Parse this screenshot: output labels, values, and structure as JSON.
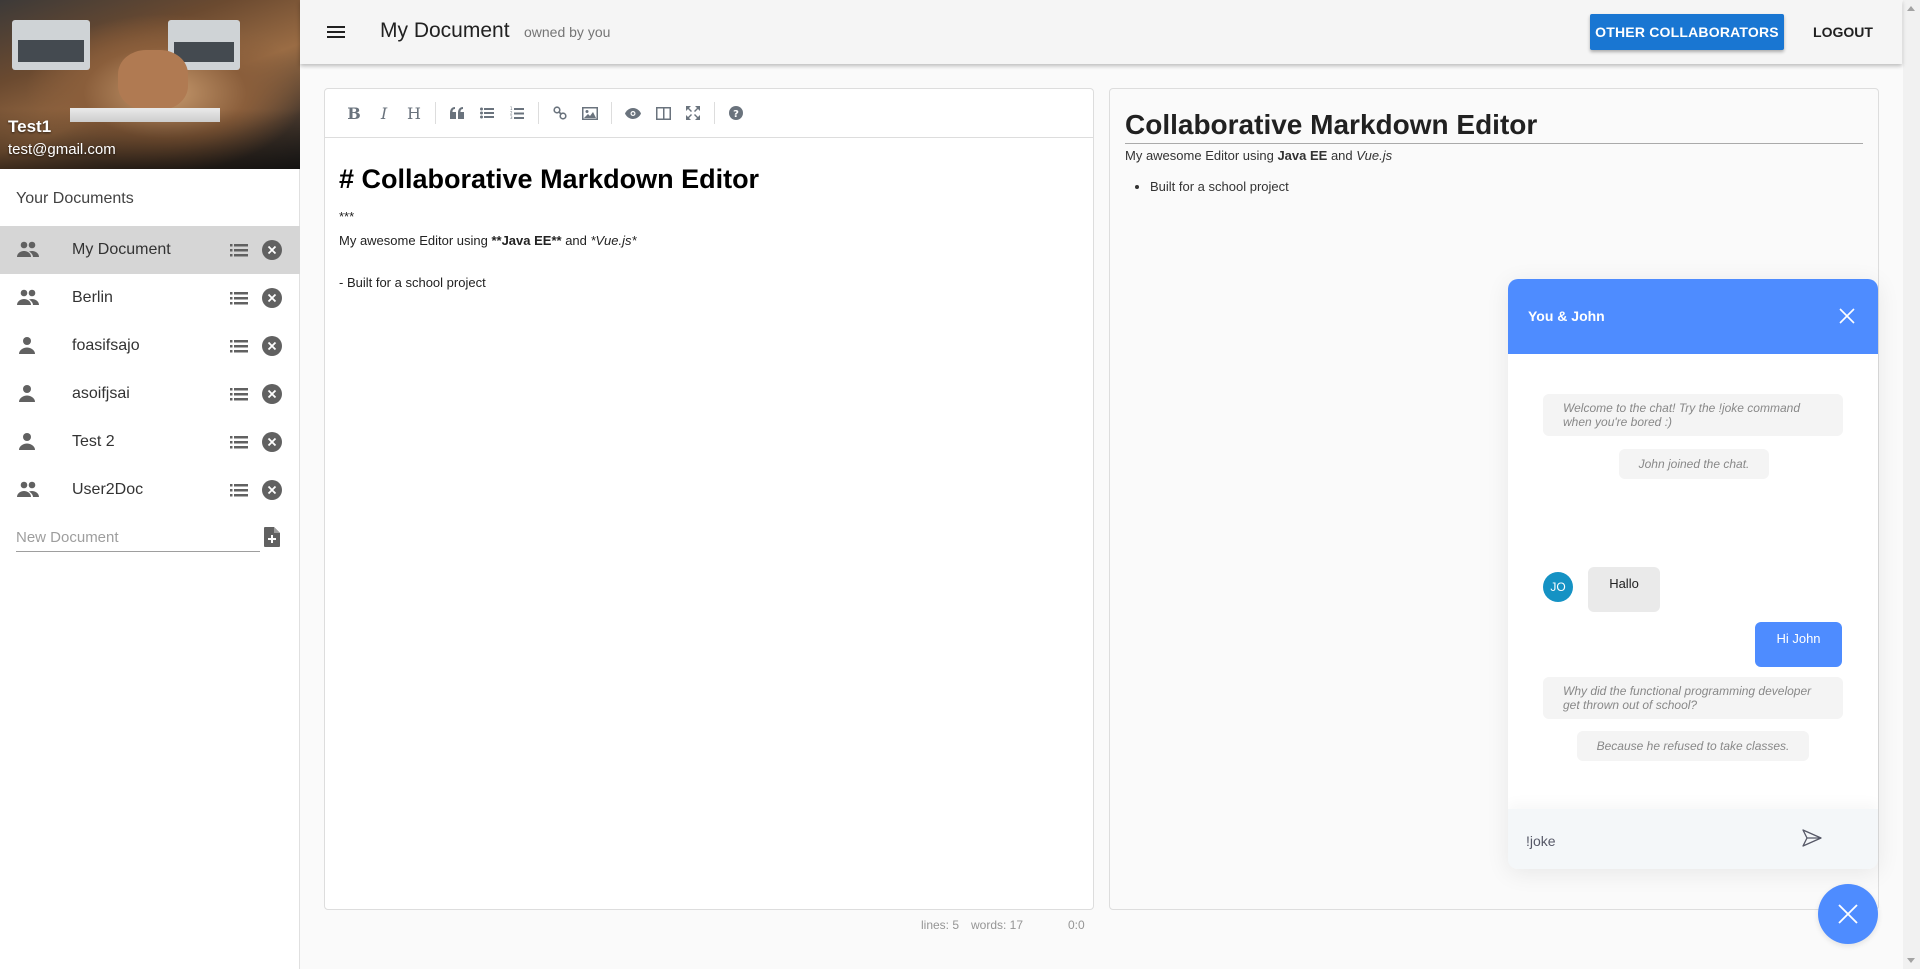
{
  "profile": {
    "name": "Test1",
    "email": "test@gmail.com",
    "image": "team-fist-bump-photo"
  },
  "sidebar": {
    "heading": "Your Documents",
    "documents": [
      {
        "name": "My Document",
        "icon": "people-icon",
        "shared": true,
        "active": true
      },
      {
        "name": "Berlin",
        "icon": "people-icon",
        "shared": true,
        "active": false
      },
      {
        "name": "foasifsajo",
        "icon": "person-icon",
        "shared": false,
        "active": false
      },
      {
        "name": "asoifjsai",
        "icon": "person-icon",
        "shared": false,
        "active": false
      },
      {
        "name": "Test 2",
        "icon": "person-icon",
        "shared": false,
        "active": false
      },
      {
        "name": "User2Doc",
        "icon": "people-icon",
        "shared": true,
        "active": false
      }
    ],
    "new_document_placeholder": "New Document",
    "new_document_value": ""
  },
  "topbar": {
    "title": "My Document",
    "owner": "owned by you",
    "collaborators_button": "OTHER COLLABORATORS",
    "logout_button": "LOGOUT",
    "accent": "#1976d2"
  },
  "editor": {
    "toolbar": [
      {
        "name": "bold",
        "glyph": "B"
      },
      {
        "name": "italic",
        "glyph": "I"
      },
      {
        "name": "heading",
        "glyph": "H"
      },
      {
        "name": "quote",
        "glyph": "❝"
      },
      {
        "name": "unordered-list",
        "glyph": "☰"
      },
      {
        "name": "ordered-list",
        "glyph": "☷"
      },
      {
        "name": "link",
        "glyph": "🔗"
      },
      {
        "name": "image",
        "glyph": "▣"
      },
      {
        "name": "preview",
        "glyph": "◉"
      },
      {
        "name": "side-by-side",
        "glyph": "◫"
      },
      {
        "name": "fullscreen",
        "glyph": "⤢"
      },
      {
        "name": "guide",
        "glyph": "?"
      }
    ],
    "content": {
      "heading": "# Collaborative Markdown Editor",
      "rule": "***",
      "line_prefix": "My awesome Editor using ",
      "bold_marker_open": "**",
      "bold_text": "Java EE",
      "bold_marker_close": "**",
      "and": " and ",
      "italic_text": "*Vue.js*",
      "list_item": "- Built for a school project"
    },
    "status": {
      "lines": "lines: 5",
      "words": "words: 17",
      "cursor": "0:0"
    }
  },
  "preview": {
    "heading": "Collaborative Markdown Editor",
    "para_prefix": "My awesome Editor using ",
    "para_bold": "Java EE",
    "para_and": " and ",
    "para_italic": "Vue.js",
    "list": [
      "Built for a school project"
    ]
  },
  "chat": {
    "title": "You & John",
    "accent": "#4e8cff",
    "messages": [
      {
        "type": "system",
        "text": "Welcome to the chat! Try the !joke command when you're bored :)"
      },
      {
        "type": "system",
        "text": "John joined the chat."
      },
      {
        "type": "incoming",
        "author_initials": "JO",
        "text": "Hallo"
      },
      {
        "type": "outgoing",
        "text": "Hi John"
      },
      {
        "type": "system",
        "text": "Why did the functional programming developer get thrown out of school?"
      },
      {
        "type": "system",
        "text": "Because he refused to take classes."
      }
    ],
    "input_value": "!joke",
    "input_placeholder": ""
  }
}
